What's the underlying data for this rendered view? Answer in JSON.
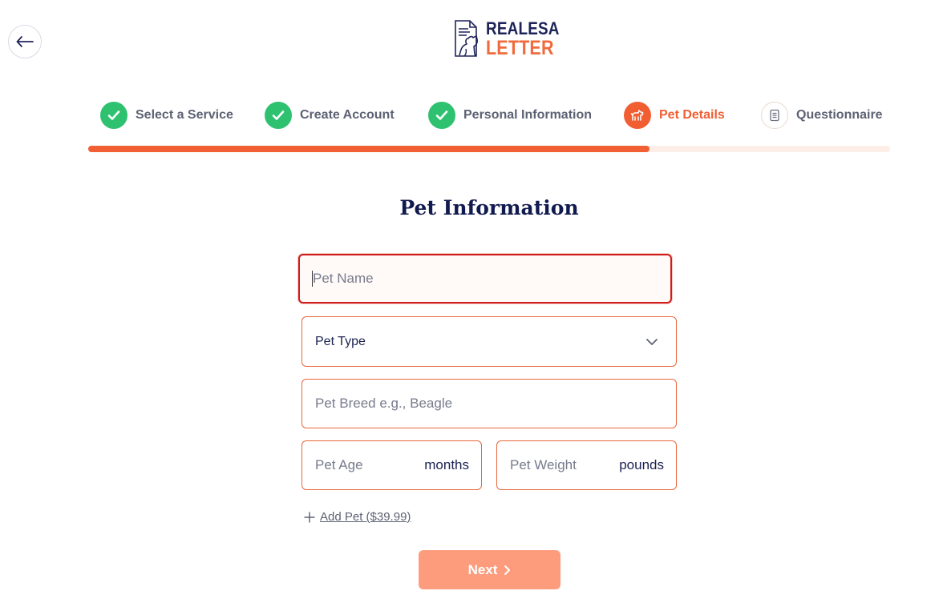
{
  "logo": {
    "line1": "REALESA",
    "line2": "LETTER"
  },
  "steps": [
    {
      "label": "Select a Service",
      "status": "done",
      "icon": "check-icon"
    },
    {
      "label": "Create Account",
      "status": "done",
      "icon": "check-icon"
    },
    {
      "label": "Personal Information",
      "status": "done",
      "icon": "check-icon"
    },
    {
      "label": "Pet Details",
      "status": "active",
      "icon": "dog-icon"
    },
    {
      "label": "Questionnaire",
      "status": "pending",
      "icon": "document-icon"
    }
  ],
  "progress": {
    "fraction": 0.7
  },
  "form": {
    "title": "Pet Information",
    "pet_name_placeholder": "Pet Name",
    "pet_type_label": "Pet Type",
    "pet_breed_placeholder": "Pet Breed e.g., Beagle",
    "pet_age_placeholder": "Pet Age",
    "pet_age_unit": "months",
    "pet_weight_placeholder": "Pet Weight",
    "pet_weight_unit": "pounds",
    "add_pet_label": "Add Pet ($39.99)",
    "next_label": "Next"
  },
  "colors": {
    "accent": "#f15f34",
    "success": "#2ec270",
    "navy": "#1e2459",
    "next_button": "#fd9c7d"
  }
}
